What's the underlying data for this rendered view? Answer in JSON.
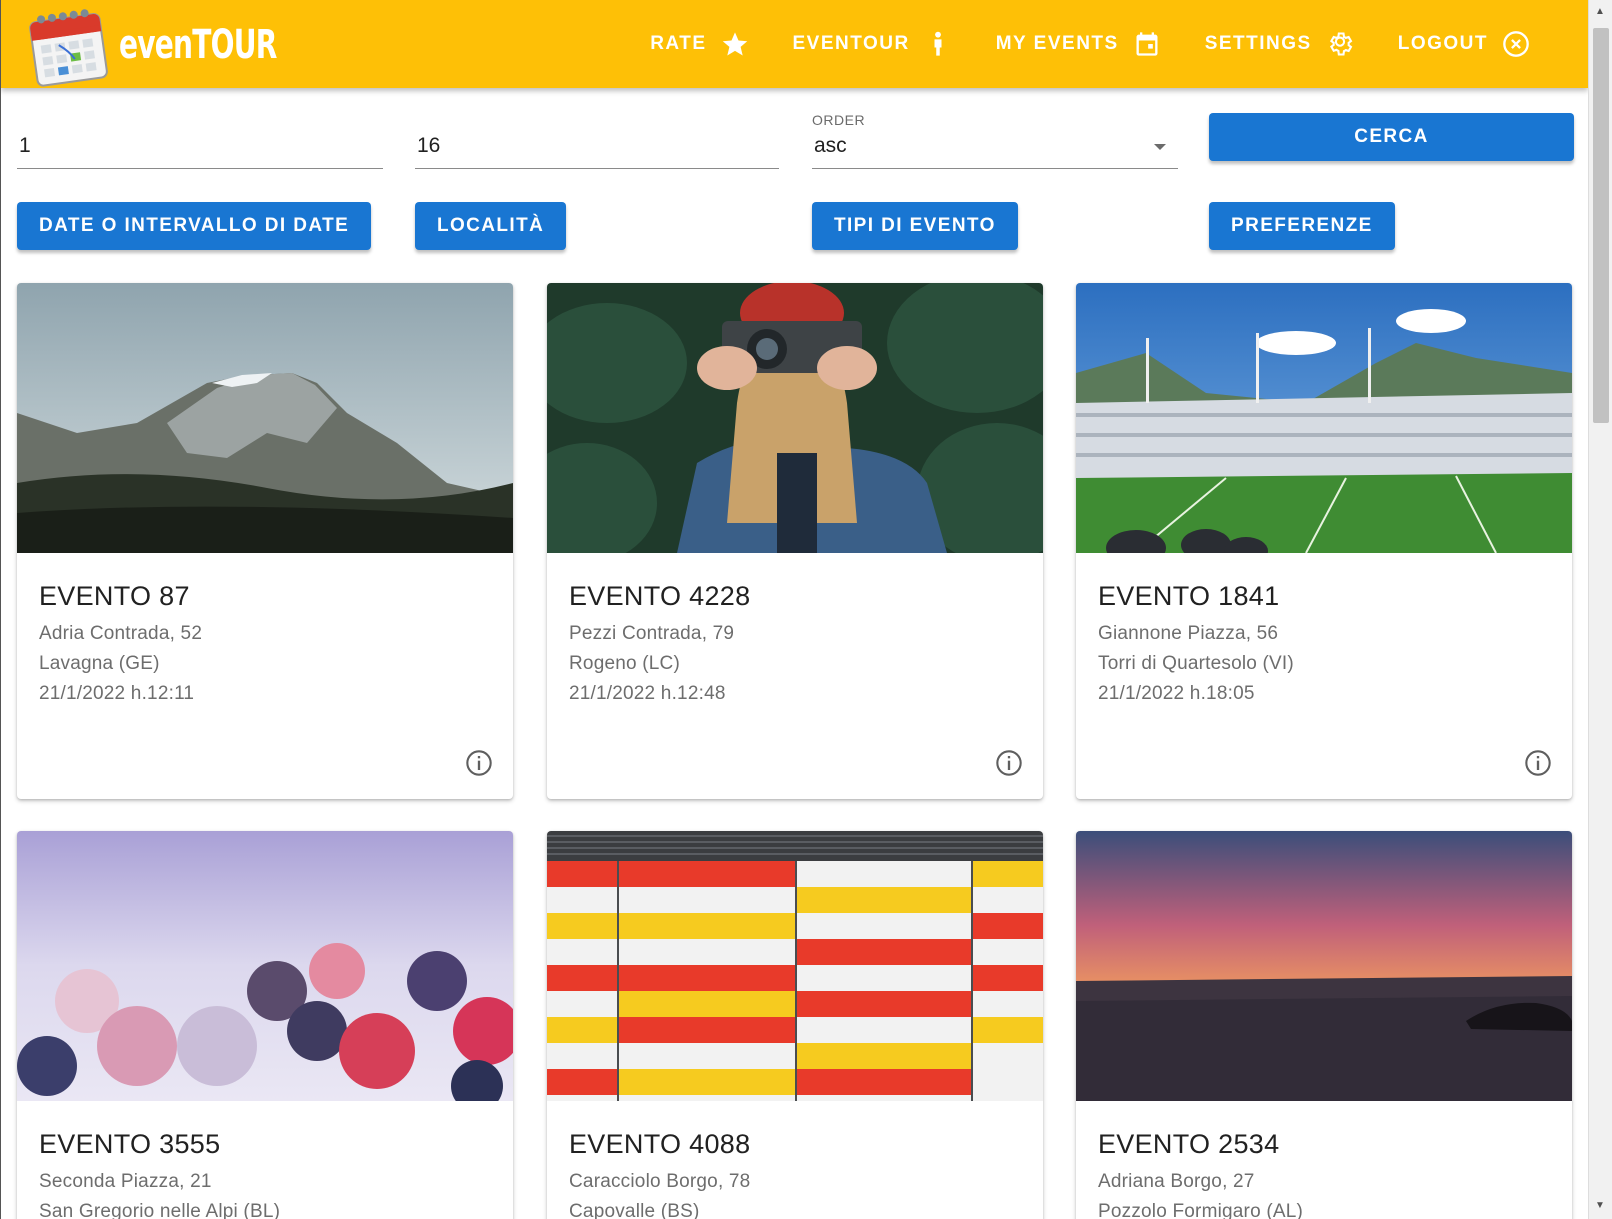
{
  "app": {
    "brand": "evenTOUR"
  },
  "nav": [
    {
      "label": "RATE",
      "icon": "star-icon"
    },
    {
      "label": "EVENTOUR",
      "icon": "person-icon"
    },
    {
      "label": "MY EVENTS",
      "icon": "calendar-icon"
    },
    {
      "label": "SETTINGS",
      "icon": "gear-icon"
    },
    {
      "label": "LOGOUT",
      "icon": "close-circle-icon"
    }
  ],
  "filters": {
    "from_value": "1",
    "to_value": "16",
    "order_label": "ORDER",
    "order_value": "asc",
    "search_label": "CERCA",
    "buttons": [
      "DATE O INTERVALLO DI DATE",
      "LOCALITÀ",
      "TIPI DI EVENTO",
      "PREFERENZE"
    ]
  },
  "events": [
    {
      "title": "EVENTO 87",
      "address": "Adria Contrada, 52",
      "city": "Lavagna (GE)",
      "datetime": "21/1/2022 h.12:11",
      "image": "mountain"
    },
    {
      "title": "EVENTO 4228",
      "address": "Pezzi Contrada, 79",
      "city": "Rogeno (LC)",
      "datetime": "21/1/2022 h.12:48",
      "image": "photographer"
    },
    {
      "title": "EVENTO 1841",
      "address": "Giannone Piazza, 56",
      "city": "Torri di Quartesolo (VI)",
      "datetime": "21/1/2022 h.18:05",
      "image": "stadium"
    },
    {
      "title": "EVENTO 3555",
      "address": "Seconda Piazza, 21",
      "city": "San Gregorio nelle Alpi (BL)",
      "datetime": "",
      "image": "frozen-berries"
    },
    {
      "title": "EVENTO 4088",
      "address": "Caracciolo Borgo, 78",
      "city": "Capovalle (BS)",
      "datetime": "",
      "image": "striped-wall"
    },
    {
      "title": "EVENTO 2534",
      "address": "Adriana Borgo, 27",
      "city": "Pozzolo Formigaro (AL)",
      "datetime": "",
      "image": "sunset-sea"
    }
  ],
  "colors": {
    "appbar": "#fec006",
    "primary": "#1976d2"
  }
}
